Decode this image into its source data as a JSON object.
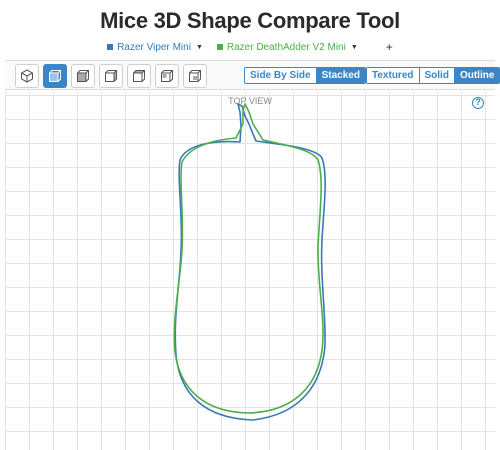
{
  "page": {
    "title": "Mice 3D Shape Compare Tool"
  },
  "mice": [
    {
      "name": "Razer Viper Mini",
      "color": "#3a78b8"
    },
    {
      "name": "Razer DeathAdder V2 Mini",
      "color": "#4cae4c"
    }
  ],
  "add_label": "+",
  "toolbar": {
    "view_icons": [
      "perspective-view-icon",
      "top-view-icon",
      "front-view-icon",
      "back-view-icon",
      "left-view-icon",
      "right-view-icon",
      "bottom-view-icon"
    ],
    "active_view": "top-view-icon",
    "layout": {
      "options": [
        "Side By Side",
        "Stacked"
      ],
      "active": "Stacked"
    },
    "render": {
      "options": [
        "Textured",
        "Solid",
        "Outline"
      ],
      "active": "Outline"
    }
  },
  "canvas": {
    "view_label": "TOP VIEW",
    "help_label": "?"
  },
  "colors": {
    "accent": "#3b86c6"
  }
}
